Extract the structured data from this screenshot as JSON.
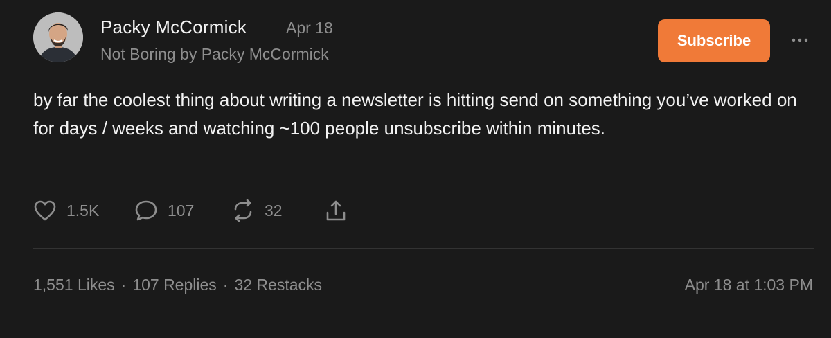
{
  "post": {
    "author_name": "Packy McCormick",
    "date": "Apr 18",
    "publication": "Not Boring by Packy McCormick",
    "subscribe_label": "Subscribe",
    "text": "by far the coolest thing about writing a newsletter is hitting send on something you’ve worked on for days / weeks and watching ~100 people unsubscribe within minutes."
  },
  "actions": {
    "likes": "1.5K",
    "comments": "107",
    "restacks": "32"
  },
  "stats": {
    "likes": "1,551 Likes",
    "replies": "107 Replies",
    "restacks": "32 Restacks",
    "separator": "·",
    "timestamp": "Apr 18 at 1:03 PM"
  },
  "icons": {
    "more": "more-dots-icon",
    "like": "heart-icon",
    "comment": "comment-bubble-icon",
    "restack": "restack-arrows-icon",
    "share": "share-icon"
  },
  "colors": {
    "background": "#1a1a1a",
    "accent": "#f07a38",
    "text": "#f2f2f2",
    "muted": "#8e8e8e",
    "divider": "#333333"
  }
}
